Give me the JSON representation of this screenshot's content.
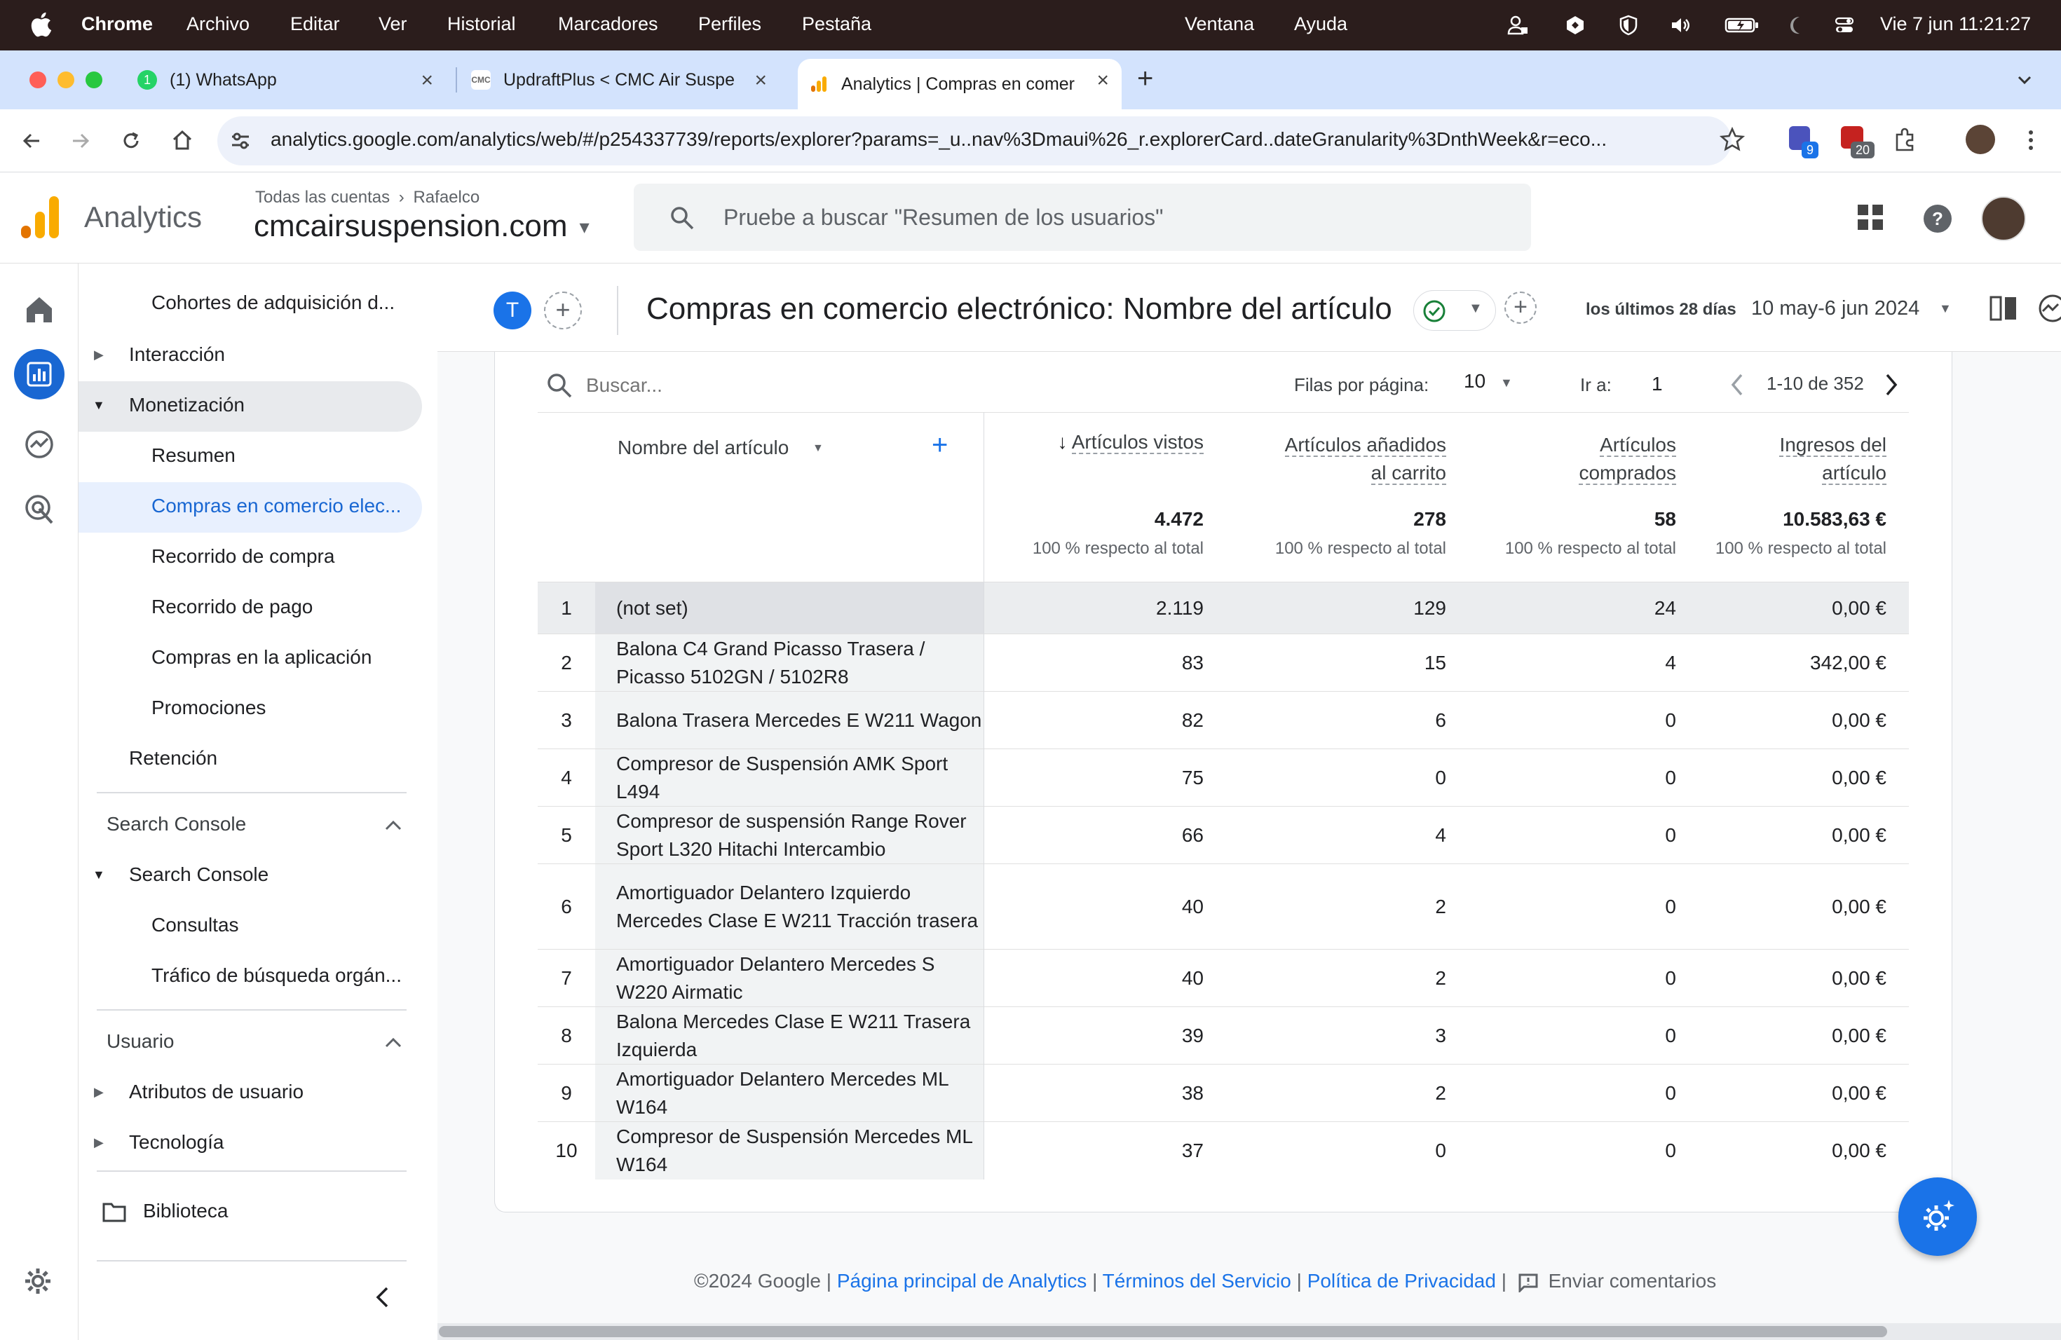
{
  "menubar": {
    "app": "Chrome",
    "items": [
      "Archivo",
      "Editar",
      "Ver",
      "Historial",
      "Marcadores",
      "Perfiles",
      "Pestaña"
    ],
    "right_items": [
      "Ventana",
      "Ayuda"
    ],
    "clock": "Vie 7 jun  11:21:27"
  },
  "tabs": [
    {
      "title": "(1) WhatsApp",
      "badge": "1"
    },
    {
      "title": "UpdraftPlus < CMC Air Suspe",
      "fav_text": "CMC"
    },
    {
      "title": "Analytics | Compras en comer"
    }
  ],
  "address": {
    "url": "analytics.google.com/analytics/web/#/p254337739/reports/explorer?params=_u..nav%3Dmaui%26_r.explorerCard..dateGranularity%3DnthWeek&r=eco..."
  },
  "extensions": {
    "badge1": "9",
    "badge2": "20"
  },
  "ga": {
    "product": "Analytics",
    "breadcrumb_all": "Todas las cuentas",
    "breadcrumb_account": "Rafaelco",
    "property": "cmcairsuspension.com",
    "search_placeholder": "Pruebe a buscar \"Resumen de los usuarios\""
  },
  "sidenav": {
    "items": [
      {
        "label": "Cohortes de adquisición d...",
        "level": "sub"
      },
      {
        "label": "Interacción",
        "level": "top"
      },
      {
        "label": "Monetización",
        "level": "top"
      },
      {
        "label": "Resumen",
        "level": "sub"
      },
      {
        "label": "Compras en comercio elec...",
        "level": "sub"
      },
      {
        "label": "Recorrido de compra",
        "level": "sub"
      },
      {
        "label": "Recorrido de pago",
        "level": "sub"
      },
      {
        "label": "Compras en la aplicación",
        "level": "sub"
      },
      {
        "label": "Promociones",
        "level": "sub"
      },
      {
        "label": "Retención",
        "level": "top"
      }
    ],
    "search_console_header": "Search Console",
    "search_console_item": "Search Console",
    "sc_items": [
      "Consultas",
      "Tráfico de búsqueda orgán..."
    ],
    "usuario_header": "Usuario",
    "usuario_items": [
      "Atributos de usuario",
      "Tecnología"
    ],
    "library": "Biblioteca"
  },
  "report": {
    "avatar_letter": "T",
    "title": "Compras en comercio electrónico: Nombre del artículo",
    "date_label": "los últimos 28 días",
    "date_range": "10 may-6 jun 2024"
  },
  "table": {
    "search_placeholder": "Buscar...",
    "rows_per_page_label": "Filas por página:",
    "rows_per_page": "10",
    "goto_label": "Ir a:",
    "goto_value": "1",
    "page_info": "1-10 de 352",
    "dimension_header": "Nombre del artículo",
    "col1_header": "Artículos vistos",
    "col2_header_a": "Artículos añadidos",
    "col2_header_b": "al carrito",
    "col3_header_a": "Artículos",
    "col3_header_b": "comprados",
    "col4_header_a": "Ingresos del",
    "col4_header_b": "artículo",
    "totals": [
      "4.472",
      "278",
      "58",
      "10.583,63 €"
    ],
    "total_sub": "100 % respecto al total",
    "rows": [
      {
        "n": "1",
        "name": "(not set)",
        "v1": "2.119",
        "v2": "129",
        "v3": "24",
        "v4": "0,00 €"
      },
      {
        "n": "2",
        "name": "Balona C4 Grand Picasso Trasera / Picasso 5102GN / 5102R8",
        "v1": "83",
        "v2": "15",
        "v3": "4",
        "v4": "342,00 €"
      },
      {
        "n": "3",
        "name": "Balona Trasera Mercedes E W211 Wagon",
        "v1": "82",
        "v2": "6",
        "v3": "0",
        "v4": "0,00 €"
      },
      {
        "n": "4",
        "name": "Compresor de Suspensión AMK Sport L494",
        "v1": "75",
        "v2": "0",
        "v3": "0",
        "v4": "0,00 €"
      },
      {
        "n": "5",
        "name": "Compresor de suspensión Range Rover Sport L320 Hitachi Intercambio",
        "v1": "66",
        "v2": "4",
        "v3": "0",
        "v4": "0,00 €"
      },
      {
        "n": "6",
        "name": "Amortiguador Delantero Izquierdo Mercedes Clase E W211 Tracción trasera",
        "v1": "40",
        "v2": "2",
        "v3": "0",
        "v4": "0,00 €"
      },
      {
        "n": "7",
        "name": "Amortiguador Delantero Mercedes S W220 Airmatic",
        "v1": "40",
        "v2": "2",
        "v3": "0",
        "v4": "0,00 €"
      },
      {
        "n": "8",
        "name": "Balona Mercedes Clase E W211 Trasera Izquierda",
        "v1": "39",
        "v2": "3",
        "v3": "0",
        "v4": "0,00 €"
      },
      {
        "n": "9",
        "name": "Amortiguador Delantero Mercedes ML W164",
        "v1": "38",
        "v2": "2",
        "v3": "0",
        "v4": "0,00 €"
      },
      {
        "n": "10",
        "name": "Compresor de Suspensión Mercedes ML W164",
        "v1": "37",
        "v2": "0",
        "v3": "0",
        "v4": "0,00 €"
      }
    ]
  },
  "footer": {
    "copyright": "©2024 Google",
    "link1": "Página principal de Analytics",
    "link2": "Términos del Servicio",
    "link3": "Política de Privacidad",
    "feedback": "Enviar comentarios",
    "sep": "|"
  },
  "colors": {
    "accent": "#1a73e8",
    "menubar": "#2b1d1c",
    "tabstrip": "#d3e3fd",
    "ga_orange": "#f9ab00",
    "ga_orange_dark": "#e37400"
  }
}
